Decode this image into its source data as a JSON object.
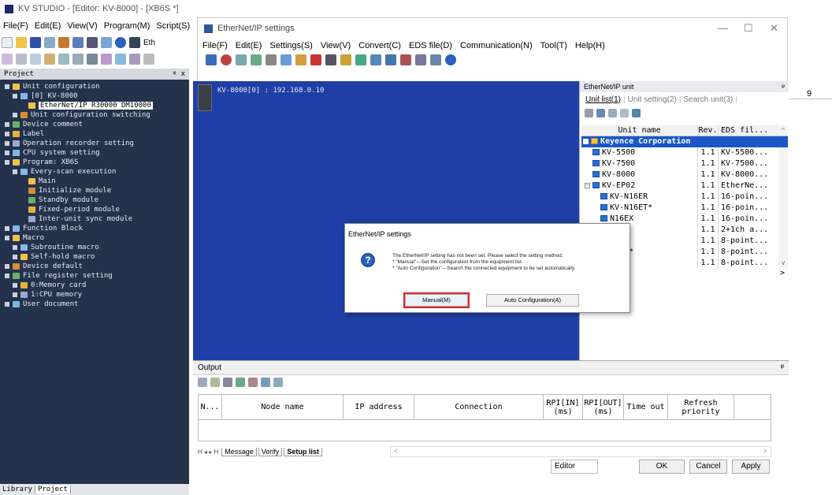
{
  "main_window": {
    "title": "KV STUDIO - [Editor: KV-8000] - [XB6S *]",
    "menu": [
      "File(F)",
      "Edit(E)",
      "View(V)",
      "Program(M)",
      "Script(S)"
    ],
    "eth_label": "Eth"
  },
  "project_pane": {
    "title": "Project",
    "pin": "ᵠ x",
    "tree": [
      {
        "label": "Unit configuration",
        "level": 0
      },
      {
        "label": "[0]  KV-8000",
        "level": 1
      },
      {
        "label": "EtherNet/IP  R30000  DM10000",
        "level": 2,
        "highlight": true
      },
      {
        "label": "Unit configuration switching",
        "level": 1
      },
      {
        "label": "Device comment",
        "level": 0
      },
      {
        "label": "Label",
        "level": 0
      },
      {
        "label": "Operation recorder setting",
        "level": 0
      },
      {
        "label": "CPU system setting",
        "level": 0
      },
      {
        "label": "Program: XB6S",
        "level": 0
      },
      {
        "label": "Every-scan execution",
        "level": 1
      },
      {
        "label": "Main",
        "level": 2
      },
      {
        "label": "Initialize module",
        "level": 2
      },
      {
        "label": "Standby module",
        "level": 2
      },
      {
        "label": "Fixed-period module",
        "level": 2
      },
      {
        "label": "Inter-unit sync module",
        "level": 2
      },
      {
        "label": "Function Block",
        "level": 0
      },
      {
        "label": "Macro",
        "level": 0
      },
      {
        "label": "Subroutine macro",
        "level": 1
      },
      {
        "label": "Self-hold macro",
        "level": 1
      },
      {
        "label": "Device default",
        "level": 0
      },
      {
        "label": "File register setting",
        "level": 0
      },
      {
        "label": "0:Memory card",
        "level": 1
      },
      {
        "label": "1:CPU memory",
        "level": 1
      },
      {
        "label": "User document",
        "level": 0
      }
    ],
    "bottom_tabs": [
      "Library",
      "Project"
    ]
  },
  "bg_grid": {
    "column_label": "9"
  },
  "eip_window": {
    "title": "EtherNet/IP settings",
    "controls": {
      "minimize": "—",
      "maximize": "☐",
      "close": "✕"
    },
    "menu": [
      "File(F)",
      "Edit(E)",
      "Settings(S)",
      "View(V)",
      "Convert(C)",
      "EDS file(D)",
      "Communication(N)",
      "Tool(T)",
      "Help(H)"
    ],
    "device_label": "KV-8000[0] : 192.168.0.10",
    "unit_panel": {
      "title": "EtherNet/IP unit",
      "pin": "ᵠ",
      "tabs": [
        "Unit list(1)",
        "Unit setting(2)",
        "Search unit(3)"
      ],
      "columns": [
        "Unit name",
        "Rev.",
        "EDS fil..."
      ],
      "group": "Keyence Corporation",
      "rows": [
        {
          "name": "KV-5500",
          "rev": "1.1",
          "eds": "KV-5500...",
          "indent": 1,
          "expander": ""
        },
        {
          "name": "KV-7500",
          "rev": "1.1",
          "eds": "KV-7500...",
          "indent": 1,
          "expander": ""
        },
        {
          "name": "KV-8000",
          "rev": "1.1",
          "eds": "KV-8000...",
          "indent": 1,
          "expander": ""
        },
        {
          "name": "KV-EP02",
          "rev": "1.1",
          "eds": "EtherNe...",
          "indent": 0,
          "expander": "−"
        },
        {
          "name": "KV-N16ER",
          "rev": "1.1",
          "eds": "16-poin...",
          "indent": 2,
          "expander": ""
        },
        {
          "name": "KV-N16ET*",
          "rev": "1.1",
          "eds": "16-poin...",
          "indent": 2,
          "expander": ""
        },
        {
          "name": "N16EX",
          "rev": "1.1",
          "eds": "16-poin...",
          "indent": 2,
          "expander": ""
        },
        {
          "name": "N3AM",
          "rev": "1.1",
          "eds": "2+1ch a...",
          "indent": 2,
          "expander": ""
        },
        {
          "name": "N8ER",
          "rev": "1.1",
          "eds": "8-point...",
          "indent": 2,
          "expander": ""
        },
        {
          "name": "N8ET*",
          "rev": "1.1",
          "eds": "8-point...",
          "indent": 2,
          "expander": ""
        },
        {
          "name": "N8EX",
          "rev": "1.1",
          "eds": "8-point...",
          "indent": 2,
          "expander": ""
        }
      ],
      "scroll_up": "^",
      "scroll_down": "v",
      "scroll_right": ">"
    },
    "output": {
      "title": "Output",
      "pin": "ᵠ",
      "columns": [
        "N...",
        "Node name",
        "IP address",
        "Connection",
        "RPI[IN]\n(ms)",
        "RPI[OUT]\n(ms)",
        "Time out",
        "Refresh\npriority"
      ],
      "tabs": [
        "Message",
        "Verify",
        "Setup list"
      ],
      "nav": "H ◂ ▸ H",
      "scroll_left": "<",
      "scroll_right": ">"
    },
    "status": {
      "mode": "Editor"
    },
    "buttons": {
      "ok": "OK",
      "cancel": "Cancel",
      "apply": "Apply"
    }
  },
  "popup": {
    "title": "EtherNet/IP settings",
    "message_lines": [
      "The EtherNet/IP setting has not been set. Please select the setting method.",
      "* \"Manual\"---Set the configuration from the equipment list.",
      "* \"Auto Configuration\"---Search the connected equipment to be set automatically."
    ],
    "manual_label": "Manual(M)",
    "auto_label": "Auto Configuration(A)",
    "highlight_color": "#e02020"
  },
  "colors": {
    "canvas_blue": "#1f3fa6",
    "project_bg": "#24324c",
    "group_row": "#1a56c8"
  }
}
